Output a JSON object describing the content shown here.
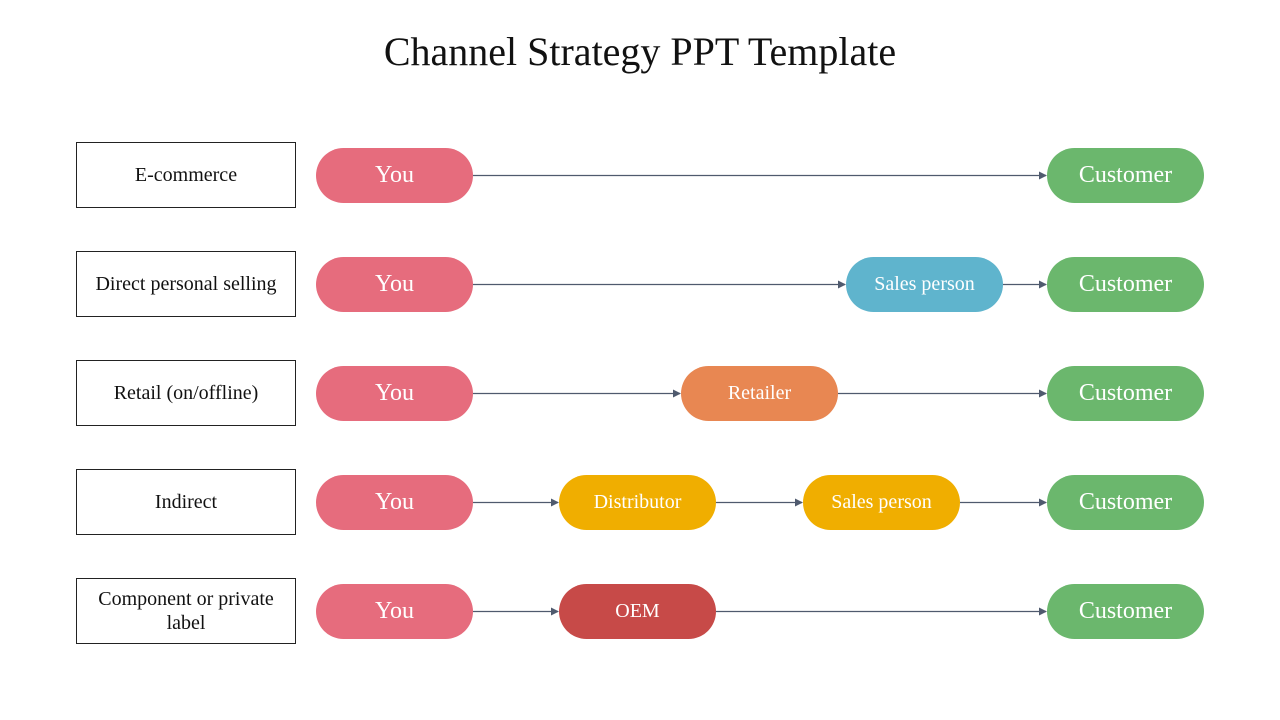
{
  "title": "Channel Strategy PPT Template",
  "colors": {
    "you": "#E66C7D",
    "customer": "#6BB76D",
    "sales_person_blue": "#5FB4CD",
    "retailer": "#E88752",
    "distributor": "#F0AE00",
    "sales_person_yellow": "#F0AE00",
    "oem": "#C74A48",
    "arrow": "#4F5A6E"
  },
  "rows": [
    {
      "label": "E-commerce",
      "nodes": [
        {
          "text": "You",
          "color": "#E66C7D",
          "slot": 0
        },
        {
          "text": "Customer",
          "color": "#6BB76D",
          "slot": 4
        }
      ]
    },
    {
      "label": "Direct personal selling",
      "nodes": [
        {
          "text": "You",
          "color": "#E66C7D",
          "slot": 0
        },
        {
          "text": "Sales person",
          "color": "#5FB4CD",
          "slot": 3
        },
        {
          "text": "Customer",
          "color": "#6BB76D",
          "slot": 4
        }
      ]
    },
    {
      "label": "Retail (on/offline)",
      "nodes": [
        {
          "text": "You",
          "color": "#E66C7D",
          "slot": 0
        },
        {
          "text": "Retailer",
          "color": "#E88752",
          "slot": 2
        },
        {
          "text": "Customer",
          "color": "#6BB76D",
          "slot": 4
        }
      ]
    },
    {
      "label": "Indirect",
      "nodes": [
        {
          "text": "You",
          "color": "#E66C7D",
          "slot": 0
        },
        {
          "text": "Distributor",
          "color": "#F0AE00",
          "slot": 1
        },
        {
          "text": "Sales person",
          "color": "#F0AE00",
          "slot": 2.8
        },
        {
          "text": "Customer",
          "color": "#6BB76D",
          "slot": 4
        }
      ]
    },
    {
      "label": "Component or private label",
      "nodes": [
        {
          "text": "You",
          "color": "#E66C7D",
          "slot": 0
        },
        {
          "text": "OEM",
          "color": "#C74A48",
          "slot": 1
        },
        {
          "text": "Customer",
          "color": "#6BB76D",
          "slot": 4
        }
      ]
    }
  ]
}
